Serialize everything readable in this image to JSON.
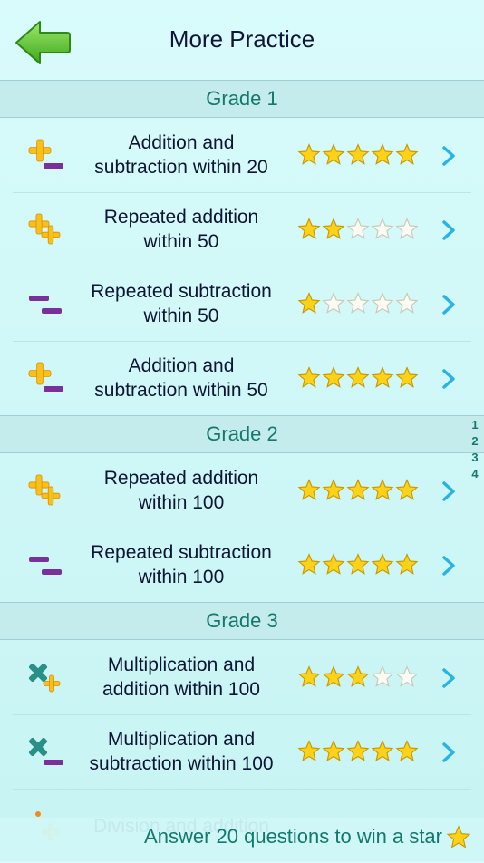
{
  "header": {
    "title": "More Practice",
    "back_icon": "arrow-left-icon"
  },
  "sections": [
    {
      "title": "Grade 1",
      "items": [
        {
          "line1": "Addition and",
          "line2": "subtraction within 20",
          "icon": "plus-minus-icon",
          "stars": 5
        },
        {
          "line1": "Repeated addition",
          "line2": "within 50",
          "icon": "plus-plus-icon",
          "stars": 2
        },
        {
          "line1": "Repeated subtraction",
          "line2": "within 50",
          "icon": "minus-minus-icon",
          "stars": 1
        },
        {
          "line1": "Addition and",
          "line2": "subtraction within 50",
          "icon": "plus-minus-icon",
          "stars": 5
        }
      ]
    },
    {
      "title": "Grade 2",
      "items": [
        {
          "line1": "Repeated addition",
          "line2": "within 100",
          "icon": "plus-plus-icon",
          "stars": 5
        },
        {
          "line1": "Repeated subtraction",
          "line2": "within 100",
          "icon": "minus-minus-icon",
          "stars": 5
        }
      ]
    },
    {
      "title": "Grade 3",
      "items": [
        {
          "line1": "Multiplication and",
          "line2": "addition within 100",
          "icon": "times-plus-icon",
          "stars": 3
        },
        {
          "line1": "Multiplication and",
          "line2": "subtraction within 100",
          "icon": "times-minus-icon",
          "stars": 5
        },
        {
          "line1": "Division and addition",
          "line2": "",
          "icon": "divide-plus-icon",
          "stars": 0
        }
      ]
    }
  ],
  "index": [
    "1",
    "2",
    "3",
    "4"
  ],
  "footer": {
    "text": "Answer 20 questions to win a star"
  },
  "colors": {
    "plus": "#f6c21a",
    "minus": "#7a2f9b",
    "times": "#2a8f86",
    "star_fill": "#ffd21a",
    "chevron": "#2ab3e6",
    "accent": "#14786c"
  }
}
